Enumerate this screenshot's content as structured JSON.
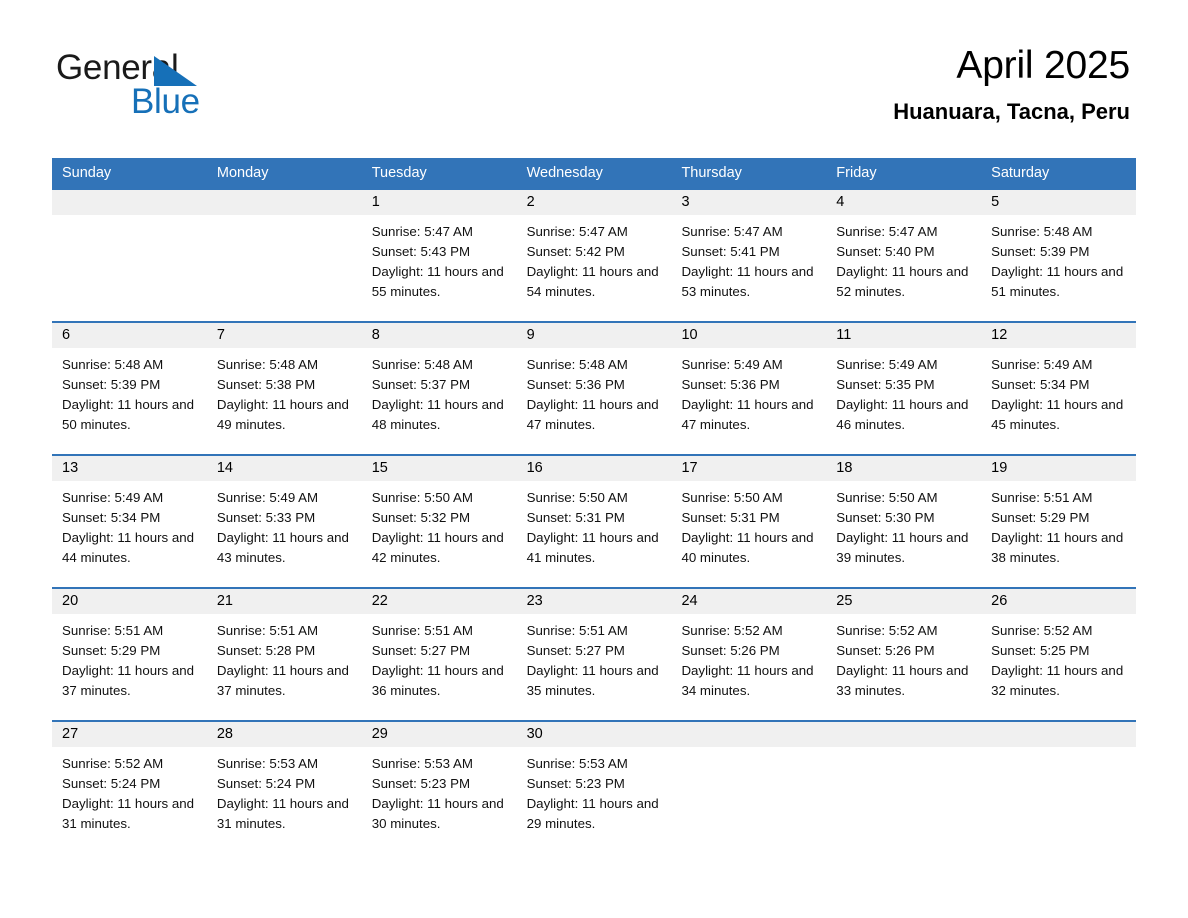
{
  "brand": {
    "name_part1": "General",
    "name_part2": "Blue",
    "accent_color": "#1670b8"
  },
  "header": {
    "title": "April 2025",
    "subtitle": "Huanuara, Tacna, Peru"
  },
  "theme": {
    "header_blue": "#3274b8",
    "day_band_gray": "#f0f0f0"
  },
  "weekdays": [
    "Sunday",
    "Monday",
    "Tuesday",
    "Wednesday",
    "Thursday",
    "Friday",
    "Saturday"
  ],
  "weeks": [
    [
      {
        "day": "",
        "sunrise": "",
        "sunset": "",
        "daylight": ""
      },
      {
        "day": "",
        "sunrise": "",
        "sunset": "",
        "daylight": ""
      },
      {
        "day": "1",
        "sunrise": "Sunrise: 5:47 AM",
        "sunset": "Sunset: 5:43 PM",
        "daylight": "Daylight: 11 hours and 55 minutes."
      },
      {
        "day": "2",
        "sunrise": "Sunrise: 5:47 AM",
        "sunset": "Sunset: 5:42 PM",
        "daylight": "Daylight: 11 hours and 54 minutes."
      },
      {
        "day": "3",
        "sunrise": "Sunrise: 5:47 AM",
        "sunset": "Sunset: 5:41 PM",
        "daylight": "Daylight: 11 hours and 53 minutes."
      },
      {
        "day": "4",
        "sunrise": "Sunrise: 5:47 AM",
        "sunset": "Sunset: 5:40 PM",
        "daylight": "Daylight: 11 hours and 52 minutes."
      },
      {
        "day": "5",
        "sunrise": "Sunrise: 5:48 AM",
        "sunset": "Sunset: 5:39 PM",
        "daylight": "Daylight: 11 hours and 51 minutes."
      }
    ],
    [
      {
        "day": "6",
        "sunrise": "Sunrise: 5:48 AM",
        "sunset": "Sunset: 5:39 PM",
        "daylight": "Daylight: 11 hours and 50 minutes."
      },
      {
        "day": "7",
        "sunrise": "Sunrise: 5:48 AM",
        "sunset": "Sunset: 5:38 PM",
        "daylight": "Daylight: 11 hours and 49 minutes."
      },
      {
        "day": "8",
        "sunrise": "Sunrise: 5:48 AM",
        "sunset": "Sunset: 5:37 PM",
        "daylight": "Daylight: 11 hours and 48 minutes."
      },
      {
        "day": "9",
        "sunrise": "Sunrise: 5:48 AM",
        "sunset": "Sunset: 5:36 PM",
        "daylight": "Daylight: 11 hours and 47 minutes."
      },
      {
        "day": "10",
        "sunrise": "Sunrise: 5:49 AM",
        "sunset": "Sunset: 5:36 PM",
        "daylight": "Daylight: 11 hours and 47 minutes."
      },
      {
        "day": "11",
        "sunrise": "Sunrise: 5:49 AM",
        "sunset": "Sunset: 5:35 PM",
        "daylight": "Daylight: 11 hours and 46 minutes."
      },
      {
        "day": "12",
        "sunrise": "Sunrise: 5:49 AM",
        "sunset": "Sunset: 5:34 PM",
        "daylight": "Daylight: 11 hours and 45 minutes."
      }
    ],
    [
      {
        "day": "13",
        "sunrise": "Sunrise: 5:49 AM",
        "sunset": "Sunset: 5:34 PM",
        "daylight": "Daylight: 11 hours and 44 minutes."
      },
      {
        "day": "14",
        "sunrise": "Sunrise: 5:49 AM",
        "sunset": "Sunset: 5:33 PM",
        "daylight": "Daylight: 11 hours and 43 minutes."
      },
      {
        "day": "15",
        "sunrise": "Sunrise: 5:50 AM",
        "sunset": "Sunset: 5:32 PM",
        "daylight": "Daylight: 11 hours and 42 minutes."
      },
      {
        "day": "16",
        "sunrise": "Sunrise: 5:50 AM",
        "sunset": "Sunset: 5:31 PM",
        "daylight": "Daylight: 11 hours and 41 minutes."
      },
      {
        "day": "17",
        "sunrise": "Sunrise: 5:50 AM",
        "sunset": "Sunset: 5:31 PM",
        "daylight": "Daylight: 11 hours and 40 minutes."
      },
      {
        "day": "18",
        "sunrise": "Sunrise: 5:50 AM",
        "sunset": "Sunset: 5:30 PM",
        "daylight": "Daylight: 11 hours and 39 minutes."
      },
      {
        "day": "19",
        "sunrise": "Sunrise: 5:51 AM",
        "sunset": "Sunset: 5:29 PM",
        "daylight": "Daylight: 11 hours and 38 minutes."
      }
    ],
    [
      {
        "day": "20",
        "sunrise": "Sunrise: 5:51 AM",
        "sunset": "Sunset: 5:29 PM",
        "daylight": "Daylight: 11 hours and 37 minutes."
      },
      {
        "day": "21",
        "sunrise": "Sunrise: 5:51 AM",
        "sunset": "Sunset: 5:28 PM",
        "daylight": "Daylight: 11 hours and 37 minutes."
      },
      {
        "day": "22",
        "sunrise": "Sunrise: 5:51 AM",
        "sunset": "Sunset: 5:27 PM",
        "daylight": "Daylight: 11 hours and 36 minutes."
      },
      {
        "day": "23",
        "sunrise": "Sunrise: 5:51 AM",
        "sunset": "Sunset: 5:27 PM",
        "daylight": "Daylight: 11 hours and 35 minutes."
      },
      {
        "day": "24",
        "sunrise": "Sunrise: 5:52 AM",
        "sunset": "Sunset: 5:26 PM",
        "daylight": "Daylight: 11 hours and 34 minutes."
      },
      {
        "day": "25",
        "sunrise": "Sunrise: 5:52 AM",
        "sunset": "Sunset: 5:26 PM",
        "daylight": "Daylight: 11 hours and 33 minutes."
      },
      {
        "day": "26",
        "sunrise": "Sunrise: 5:52 AM",
        "sunset": "Sunset: 5:25 PM",
        "daylight": "Daylight: 11 hours and 32 minutes."
      }
    ],
    [
      {
        "day": "27",
        "sunrise": "Sunrise: 5:52 AM",
        "sunset": "Sunset: 5:24 PM",
        "daylight": "Daylight: 11 hours and 31 minutes."
      },
      {
        "day": "28",
        "sunrise": "Sunrise: 5:53 AM",
        "sunset": "Sunset: 5:24 PM",
        "daylight": "Daylight: 11 hours and 31 minutes."
      },
      {
        "day": "29",
        "sunrise": "Sunrise: 5:53 AM",
        "sunset": "Sunset: 5:23 PM",
        "daylight": "Daylight: 11 hours and 30 minutes."
      },
      {
        "day": "30",
        "sunrise": "Sunrise: 5:53 AM",
        "sunset": "Sunset: 5:23 PM",
        "daylight": "Daylight: 11 hours and 29 minutes."
      },
      {
        "day": "",
        "sunrise": "",
        "sunset": "",
        "daylight": ""
      },
      {
        "day": "",
        "sunrise": "",
        "sunset": "",
        "daylight": ""
      },
      {
        "day": "",
        "sunrise": "",
        "sunset": "",
        "daylight": ""
      }
    ]
  ]
}
